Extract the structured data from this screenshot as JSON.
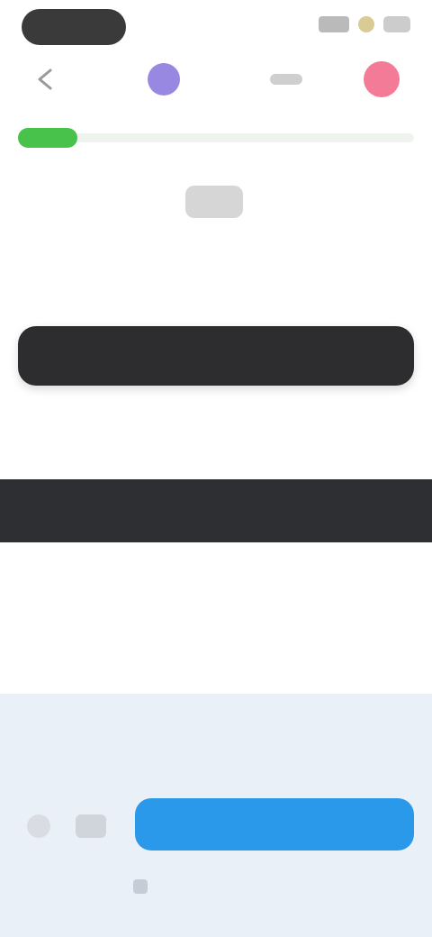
{
  "status": {
    "time": "",
    "icons": [
      "cellular-icon",
      "wifi-icon",
      "battery-icon"
    ]
  },
  "header": {
    "brand_text": "",
    "right_label": ""
  },
  "progress": {
    "value": 0.15,
    "color": "#48c24a"
  },
  "center_chip": {
    "label": ""
  },
  "question": {
    "prompt": ""
  },
  "answer_field": {
    "value": ""
  },
  "helper": {
    "text": ""
  },
  "banner": {
    "text": ""
  },
  "bottom": {
    "price_text": "",
    "primary_label": "",
    "footer_text": ""
  },
  "colors": {
    "accent_purple": "#7f6ad9",
    "accent_red": "#ef4f74",
    "primary_blue": "#2b99e9",
    "dark": "#2d2d2f"
  }
}
